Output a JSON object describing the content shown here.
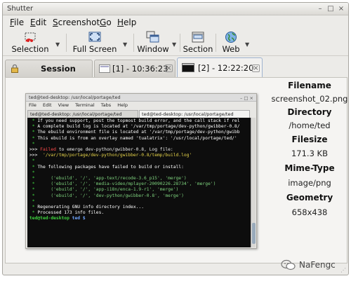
{
  "window": {
    "title": "Shutter",
    "controls": [
      "–",
      "□",
      "×"
    ]
  },
  "menu": [
    {
      "label": "File",
      "u": "F",
      "rest": "ile"
    },
    {
      "label": "Edit",
      "u": "E",
      "rest": "dit"
    },
    {
      "label": "Screenshot",
      "u": "S",
      "rest": "creenshot"
    },
    {
      "label": "Go",
      "u": "G",
      "rest": "o"
    },
    {
      "label": "Help",
      "u": "H",
      "rest": "elp"
    }
  ],
  "toolbar": {
    "selection": "Selection",
    "full_screen": "Full Screen",
    "window": "Window",
    "section": "Section",
    "web": "Web",
    "arrow": "▼"
  },
  "tabs": {
    "session": "Session",
    "tab1": "[1] - 10:36:23",
    "tab2": "[2] - 12:22:20",
    "close": "×"
  },
  "preview": {
    "title": "ted@ted-desktop: /usr/local/portage/ted",
    "controls": "– □ ×",
    "menu": [
      "File",
      "Edit",
      "View",
      "Terminal",
      "Tabs",
      "Help"
    ],
    "tab_a": "ted@ted-desktop: /usr/local/portage/ted",
    "tab_b": "ted@ted-desktop: /usr/local/portage/ted",
    "lines": [
      {
        "p": " * ",
        "t": "If you need support, post the topmost build error, and the call stack if rel",
        "c": "w"
      },
      {
        "p": " * ",
        "t": "A complete build log is located at '/var/tmp/portage/dev-python/gwibber-0.8/",
        "c": "w"
      },
      {
        "p": " * ",
        "t": "The ebuild environment file is located at '/var/tmp/portage/dev-python/gwibb",
        "c": "w"
      },
      {
        "p": " * ",
        "t": "This ebuild is from an overlay named 'tualatrix': '/usr/local/portage/ted/'",
        "c": "w"
      },
      {
        "p": " * ",
        "t": "",
        "c": "w"
      },
      {
        "p": "",
        "t": "",
        "c": "w"
      },
      {
        "p": ">>> ",
        "t": "Failed to emerge dev-python/gwibber-0.8, Log file:",
        "c": "w"
      },
      {
        "p": "",
        "t": "",
        "c": "w"
      },
      {
        "p": ">>>  ",
        "t": "'/var/tmp/portage/dev-python/gwibber-0.8/temp/build.log'",
        "c": "y"
      },
      {
        "p": " * ",
        "t": "",
        "c": "w"
      },
      {
        "p": " * ",
        "t": "The following packages have failed to build or install:",
        "c": "w"
      },
      {
        "p": " * ",
        "t": "",
        "c": "w"
      },
      {
        "p": " * ",
        "t": "     ('ebuild', '/', 'app-text/recode-3.6_p15', 'merge')",
        "c": "gd"
      },
      {
        "p": " * ",
        "t": "     ('ebuild', '/', 'media-video/mplayer-20090226.28734', 'merge')",
        "c": "gd"
      },
      {
        "p": " * ",
        "t": "     ('ebuild', '/', 'app-i18n/enca-1.9-r1', 'merge')",
        "c": "gd"
      },
      {
        "p": " * ",
        "t": "     ('ebuild', '/', 'dev-python/gwibber-0.8', 'merge')",
        "c": "gd"
      },
      {
        "p": " * ",
        "t": "",
        "c": "w"
      },
      {
        "p": "",
        "t": "",
        "c": "w"
      },
      {
        "p": "",
        "t": "",
        "c": "w"
      },
      {
        "p": " * ",
        "t": "Regenerating GNU info directory index...",
        "c": "w"
      },
      {
        "p": " * ",
        "t": "Processed 173 info files.",
        "c": "w"
      }
    ],
    "prompt_user": "ted@ted-desktop",
    "prompt_path": " ted $ ",
    "failed_word": "Failed"
  },
  "info": {
    "filename_label": "Filename",
    "filename": "screenshot_02.png",
    "directory_label": "Directory",
    "directory": "/home/ted",
    "filesize_label": "Filesize",
    "filesize": "171.3 KB",
    "mime_label": "Mime-Type",
    "mime": "image/png",
    "geometry_label": "Geometry",
    "geometry": "658x438"
  },
  "watermark": "NaFengc"
}
